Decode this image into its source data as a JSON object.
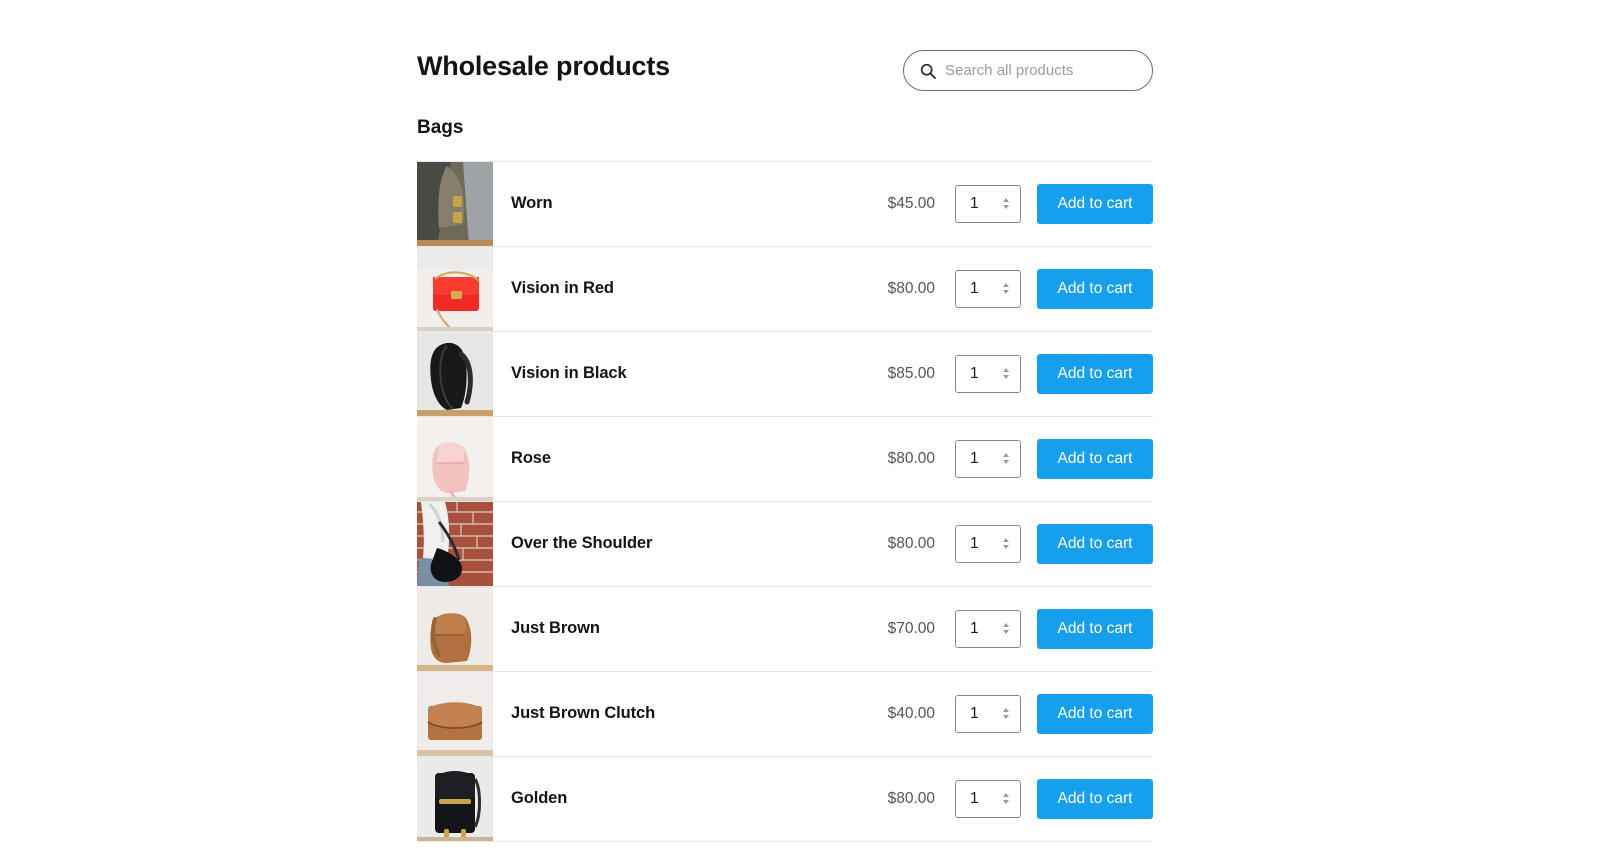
{
  "header": {
    "title": "Wholesale products",
    "search": {
      "placeholder": "Search all products",
      "value": "",
      "icon": "search-icon"
    }
  },
  "colors": {
    "accent": "#169fed",
    "button_text": "#ffffff",
    "title": "#141414",
    "price": "#555555",
    "divider": "#e6e6e6",
    "placeholder": "#9c9c9c",
    "page_background": "#ffffff"
  },
  "labels": {
    "add_to_cart": "Add to cart",
    "quantity_default": "1"
  },
  "categories": [
    {
      "name": "Bags",
      "products": [
        {
          "name": "Worn",
          "price": "$45.00",
          "quantity": "1",
          "add_label": "Add to cart",
          "image": "worn-olive-duffel-bag"
        },
        {
          "name": "Vision in Red",
          "price": "$80.00",
          "quantity": "1",
          "add_label": "Add to cart",
          "image": "red-flap-handbag"
        },
        {
          "name": "Vision in Black",
          "price": "$85.00",
          "quantity": "1",
          "add_label": "Add to cart",
          "image": "black-leather-backpack"
        },
        {
          "name": "Rose",
          "price": "$80.00",
          "quantity": "1",
          "add_label": "Add to cart",
          "image": "pink-crossbody-bag"
        },
        {
          "name": "Over the Shoulder",
          "price": "$80.00",
          "quantity": "1",
          "add_label": "Add to cart",
          "image": "model-with-black-shoulder-bag-brick-wall"
        },
        {
          "name": "Just Brown",
          "price": "$70.00",
          "quantity": "1",
          "add_label": "Add to cart",
          "image": "brown-leather-satchel"
        },
        {
          "name": "Just Brown Clutch",
          "price": "$40.00",
          "quantity": "1",
          "add_label": "Add to cart",
          "image": "brown-leather-clutch"
        },
        {
          "name": "Golden",
          "price": "$80.00",
          "quantity": "1",
          "add_label": "Add to cart",
          "image": "black-bag-gold-hardware"
        }
      ]
    }
  ]
}
